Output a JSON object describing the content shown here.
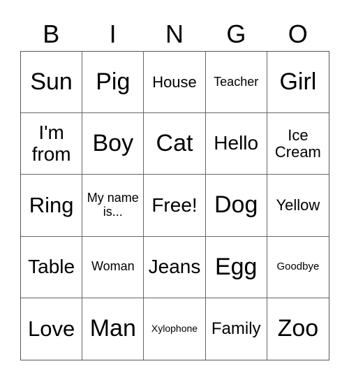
{
  "header": {
    "letters": [
      "B",
      "I",
      "N",
      "G",
      "O"
    ]
  },
  "cells": [
    "Sun",
    "Pig",
    "House",
    "Teacher",
    "Girl",
    "I'm from",
    "Boy",
    "Cat",
    "Hello",
    "Ice Cream",
    "Ring",
    "My name is...",
    "Free!",
    "Dog",
    "Yellow",
    "Table",
    "Woman",
    "Jeans",
    "Egg",
    "Goodbye",
    "Love",
    "Man",
    "Xylophone",
    "Family",
    "Zoo"
  ]
}
